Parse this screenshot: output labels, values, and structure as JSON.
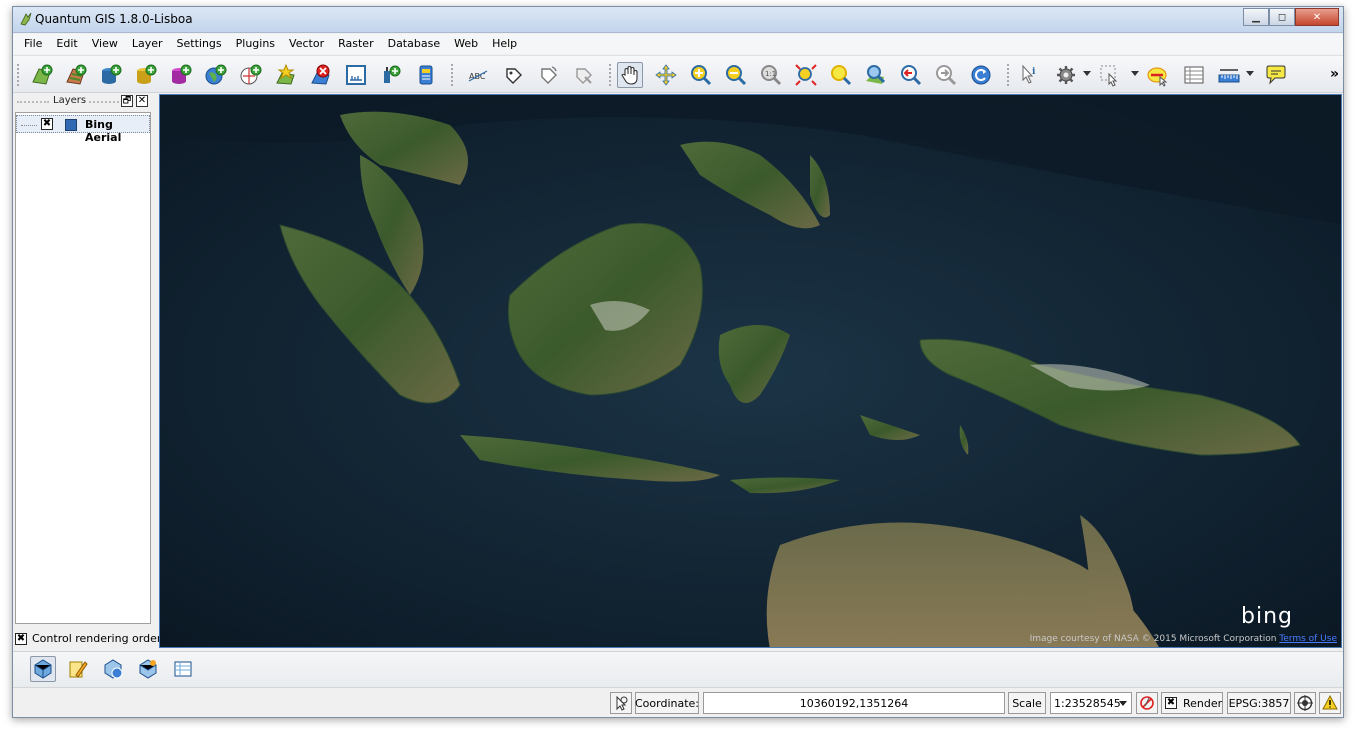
{
  "window": {
    "title": "Quantum GIS 1.8.0-Lisboa",
    "minimize_glyph": "▁",
    "maximize_glyph": "◻",
    "close_glyph": "✕"
  },
  "menu": {
    "items": [
      "File",
      "Edit",
      "View",
      "Layer",
      "Settings",
      "Plugins",
      "Vector",
      "Raster",
      "Database",
      "Web",
      "Help"
    ]
  },
  "toolbar": {
    "overflow_label": "»",
    "icons": [
      "add-vector-layer-icon",
      "add-raster-layer-icon",
      "add-postgis-layer-icon",
      "add-spatialite-layer-icon",
      "add-mssql-layer-icon",
      "add-wms-layer-icon",
      "add-wfs-layer-icon",
      "new-shapefile-icon",
      "remove-layer-icon",
      "add-delimited-text-icon",
      "plugin-icon",
      "python-console-icon",
      "label-icon",
      "move-label-icon",
      "rotate-label-icon",
      "change-label-icon",
      "pan-icon",
      "pan-to-selection-icon",
      "zoom-in-icon",
      "zoom-out-icon",
      "zoom-actual-icon",
      "zoom-full-icon",
      "zoom-to-selection-icon",
      "zoom-to-layer-icon",
      "zoom-last-icon",
      "zoom-next-icon",
      "refresh-icon",
      "identify-icon",
      "action-icon",
      "select-icon",
      "deselect-icon",
      "attribute-table-icon",
      "measure-icon",
      "tips-icon"
    ]
  },
  "layers_panel": {
    "title": "Layers",
    "float_glyph": "🗗",
    "close_glyph": "✕",
    "layers": [
      {
        "name": "Bing Aerial",
        "checked": true
      }
    ],
    "control_rendering_order": {
      "label": "Control rendering order",
      "checked": true
    },
    "check_glyph": "✖"
  },
  "map": {
    "attribution_logo": "bing",
    "credit_text": "Image courtesy of NASA © 2015 Microsoft Corporation",
    "credit_link": "Terms of Use"
  },
  "statusbar": {
    "coordinate_label": "Coordinate:",
    "coordinate_value": "10360192,1351264",
    "scale_label": "Scale",
    "scale_value": "1:23528545",
    "render_label": "Render",
    "render_checked": true,
    "crs_label": "EPSG:3857"
  }
}
